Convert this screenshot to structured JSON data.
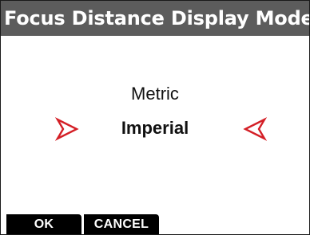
{
  "header": {
    "title": "Focus Distance Display Mode"
  },
  "options": [
    {
      "label": "Metric",
      "selected": false
    },
    {
      "label": "Imperial",
      "selected": true
    }
  ],
  "selection_arrows": {
    "color": "#d41f26",
    "left_icon": "chevron-right-icon",
    "right_icon": "chevron-left-icon"
  },
  "softkeys": {
    "ok_label": "OK",
    "cancel_label": "CANCEL"
  },
  "colors": {
    "title_bar": "#5c5c5c",
    "softkey_bg": "#000000"
  }
}
